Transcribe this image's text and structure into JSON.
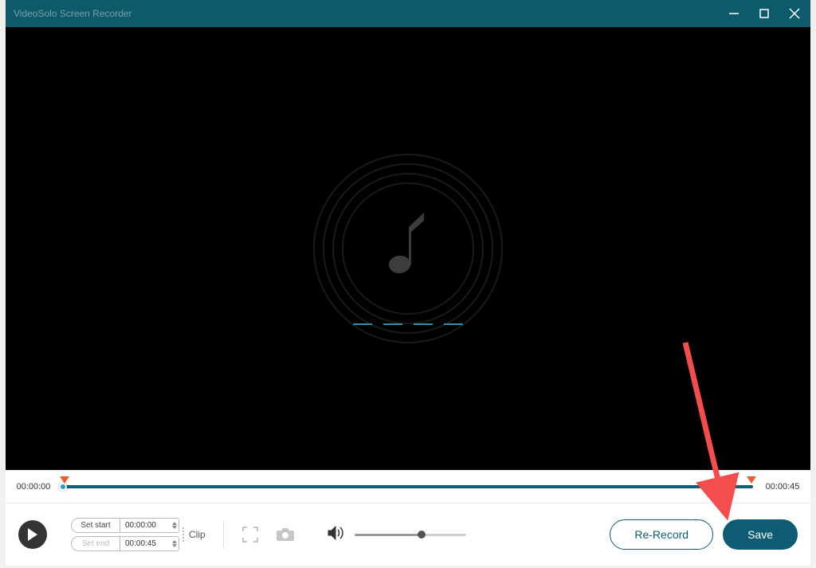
{
  "titlebar": {
    "title": "VideoSolo Screen Recorder"
  },
  "timeline": {
    "start_time": "00:00:00",
    "end_time": "00:00:45"
  },
  "clip": {
    "set_start_label": "Set start",
    "set_end_label": "Set end",
    "start_value": "00:00:00",
    "end_value": "00:00:45",
    "clip_label": "Clip"
  },
  "actions": {
    "rerecord_label": "Re-Record",
    "save_label": "Save"
  }
}
